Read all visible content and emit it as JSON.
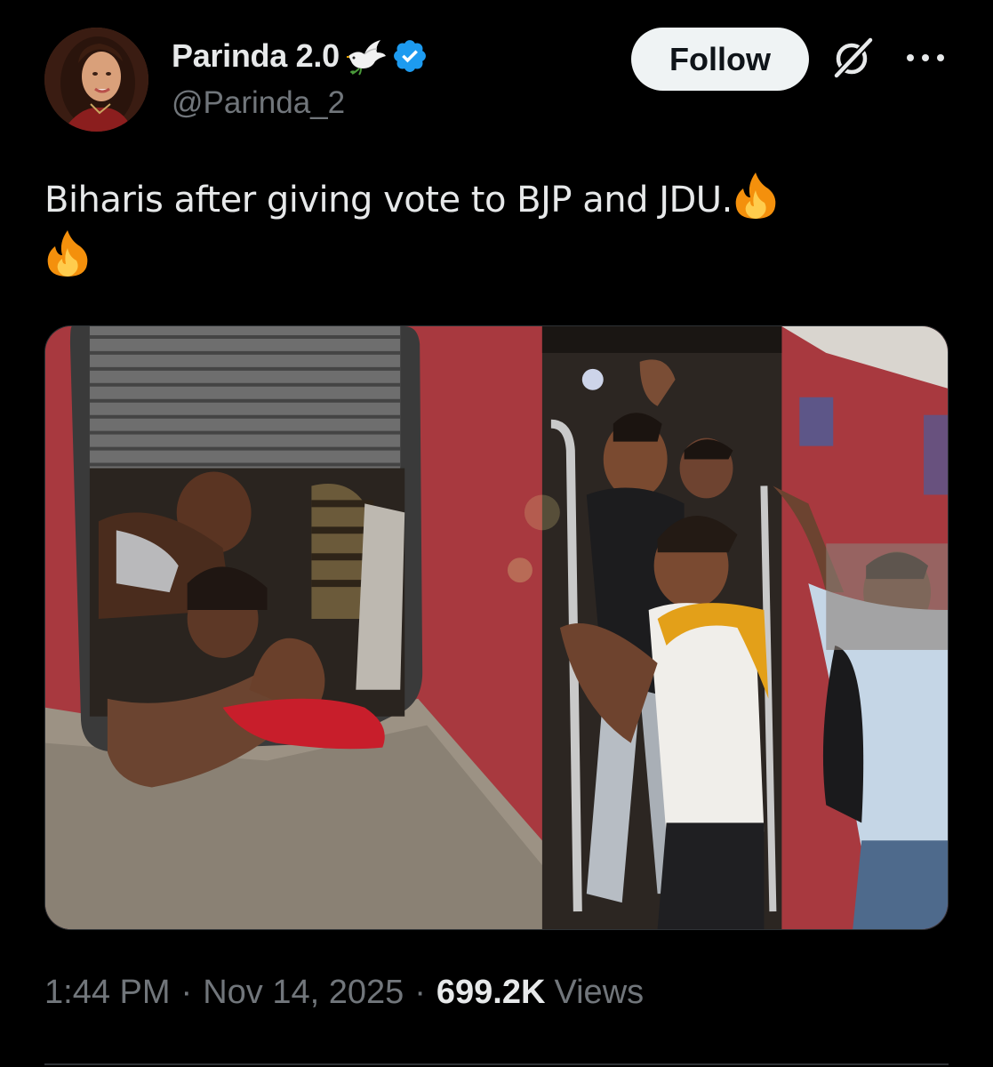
{
  "author": {
    "display_name": "Parinda 2.0",
    "handle": "@Parinda_2",
    "verified": true
  },
  "actions": {
    "follow_label": "Follow"
  },
  "icons": {
    "badge": "dove-icon",
    "verified": "verified-badge-icon",
    "grok": "grok-icon",
    "more": "more-icon",
    "emoji": "fire-icon"
  },
  "tweet": {
    "text": "Biharis after giving vote to BJP and JDU."
  },
  "meta": {
    "time": "1:44 PM",
    "date": "Nov 14, 2025",
    "views_count": "699.2K",
    "views_label": "Views",
    "separator": "·"
  },
  "colors": {
    "background": "#000000",
    "text": "#e7e9ea",
    "secondary_text": "#71767b",
    "verified_blue": "#1d9bf0",
    "follow_bg": "#eff3f4"
  }
}
